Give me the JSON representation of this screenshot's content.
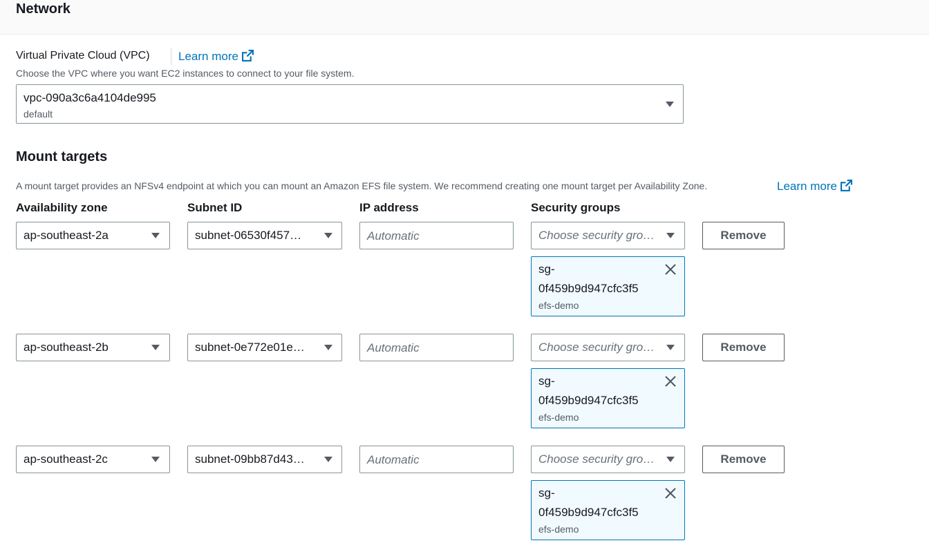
{
  "section": {
    "title": "Network"
  },
  "vpc": {
    "label": "Virtual Private Cloud (VPC)",
    "learn_more": "Learn more",
    "description": "Choose the VPC where you want EC2 instances to connect to your file system.",
    "selected": "vpc-090a3c6a4104de995",
    "selected_tag": "default"
  },
  "mount_targets": {
    "title": "Mount targets",
    "description": "A mount target provides an NFSv4 endpoint at which you can mount an Amazon EFS file system. We recommend creating one mount target per Availability Zone.",
    "learn_more": "Learn more",
    "columns": {
      "az": "Availability zone",
      "subnet": "Subnet ID",
      "ip": "IP address",
      "sg": "Security groups"
    },
    "rows": [
      {
        "az": "ap-southeast-2a",
        "subnet": "subnet-06530f457…",
        "ip_placeholder": "Automatic",
        "sg_placeholder": "Choose security gro…",
        "remove": "Remove",
        "sg_token": {
          "line1": "sg-",
          "line2": "0f459b9d947cfc3f5",
          "name": "efs-demo"
        }
      },
      {
        "az": "ap-southeast-2b",
        "subnet": "subnet-0e772e01e…",
        "ip_placeholder": "Automatic",
        "sg_placeholder": "Choose security gro…",
        "remove": "Remove",
        "sg_token": {
          "line1": "sg-",
          "line2": "0f459b9d947cfc3f5",
          "name": "efs-demo"
        }
      },
      {
        "az": "ap-southeast-2c",
        "subnet": "subnet-09bb87d43…",
        "ip_placeholder": "Automatic",
        "sg_placeholder": "Choose security gro…",
        "remove": "Remove",
        "sg_token": {
          "line1": "sg-",
          "line2": "0f459b9d947cfc3f5",
          "name": "efs-demo"
        }
      }
    ]
  },
  "icons": {
    "external_link": "external-link-icon",
    "dropdown": "caret-down-icon",
    "dismiss": "close-icon"
  },
  "colors": {
    "link": "#0073bb",
    "token_bg": "#f1faff",
    "token_border": "#0073bb"
  }
}
